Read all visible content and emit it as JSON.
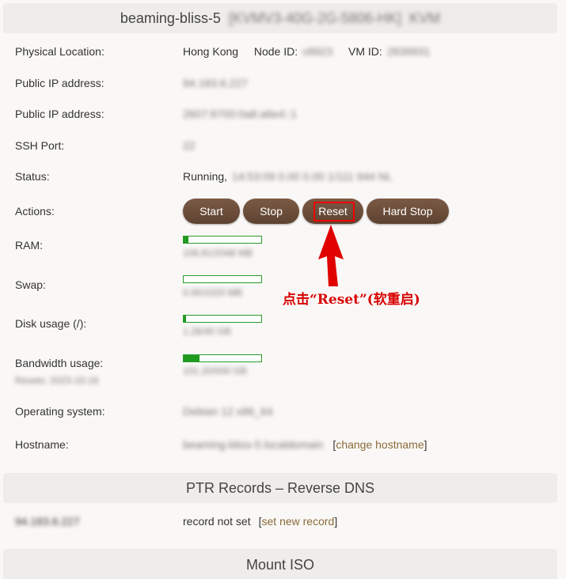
{
  "server": {
    "hostname_title": "beaming-bliss-5",
    "plan": "[KVMV3-40G-2G-5806-HK]",
    "virt": "KVM"
  },
  "labels": {
    "location": "Physical Location:",
    "ip1": "Public IP address:",
    "ip2": "Public IP address:",
    "ssh": "SSH Port:",
    "status": "Status:",
    "actions": "Actions:",
    "ram": "RAM:",
    "swap": "Swap:",
    "disk": "Disk usage (/):",
    "bandwidth": "Bandwidth usage:",
    "os": "Operating system:",
    "hostname": "Hostname:"
  },
  "values": {
    "location": "Hong Kong",
    "node_label": "Node ID:",
    "node_id": "v8923",
    "vm_label": "VM ID:",
    "vm_id": "2839931",
    "ip1": "94.183.6.227",
    "ip2": "2607:8700:0a8:a6e4::1",
    "ssh": "22",
    "status_state": "Running,",
    "status_detail": "14:53:09 0.00 0.00 1/111 944 NL",
    "ram_detail": "106.81/2048 MB",
    "swap_detail": "0.00/1020 MB",
    "disk_detail": "1.28/40 GB",
    "bw_detail": "101.20/500 GB",
    "bw_reset": "Resets: 2023-10-16",
    "os": "Debian 12 x86_64",
    "hostname": "beaming-bliss-5.localdomain",
    "change_hostname": "change hostname"
  },
  "usage": {
    "ram": 0.06,
    "swap": 0.0,
    "disk": 0.03,
    "bandwidth": 0.2
  },
  "actions": {
    "start": "Start",
    "stop": "Stop",
    "reset": "Reset",
    "hard_stop": "Hard Stop"
  },
  "annotation": "点击“Reset”(软重启)",
  "ptr": {
    "title": "PTR Records – Reverse DNS",
    "ip": "94.183.6.227",
    "record": "record not set",
    "set_link": "set new record"
  },
  "iso": {
    "title": "Mount ISO"
  },
  "colors": {
    "button": "#6b4c38",
    "bar": "#1f9a1f",
    "annotation": "#d80000",
    "link": "#8a6a3a"
  }
}
